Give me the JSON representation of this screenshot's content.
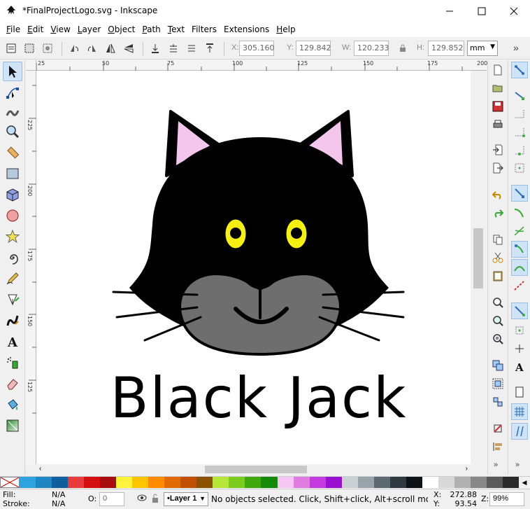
{
  "window": {
    "title": "*FinalProjectLogo.svg - Inkscape",
    "minimize_icon": "minimize-icon",
    "maximize_icon": "maximize-icon",
    "close_icon": "close-icon"
  },
  "menu": {
    "items": [
      {
        "key": "F",
        "rest": "ile"
      },
      {
        "key": "E",
        "rest": "dit"
      },
      {
        "key": "V",
        "rest": "iew"
      },
      {
        "key": "L",
        "rest": "ayer"
      },
      {
        "key": "O",
        "rest": "bject"
      },
      {
        "key": "P",
        "rest": "ath"
      },
      {
        "key": "T",
        "rest": "ext"
      },
      {
        "key": "",
        "rest": "Filters"
      },
      {
        "key": "",
        "rest": "Extensions"
      },
      {
        "key": "H",
        "rest": "elp"
      }
    ]
  },
  "toolbar": {
    "x_label": "X:",
    "x_value": "305.160",
    "y_label": "Y:",
    "y_value": "129.842",
    "w_label": "W:",
    "w_value": "120.233",
    "h_label": "H:",
    "h_value": "129.852",
    "unit": "mm",
    "overflow": "»"
  },
  "rulers": {
    "top_ticks": [
      "25",
      "50",
      "75",
      "100",
      "125",
      "150",
      "175",
      "200"
    ],
    "left_ticks": [
      "225",
      "200",
      "175",
      "150",
      "125"
    ]
  },
  "canvas": {
    "logo_text": "Black Jack",
    "colors": {
      "cat_body": "#000000",
      "ear_inner": "#f4c6ee",
      "eye": "#f5f010",
      "muzzle": "#6e6e6e"
    }
  },
  "palette": {
    "swatches": [
      "#2fa3e0",
      "#1f86c4",
      "#0f5f9e",
      "#e83c3c",
      "#d40f0f",
      "#a80d0d",
      "#fff23a",
      "#ffc400",
      "#ff8c00",
      "#e06a00",
      "#c05000",
      "#8a5200",
      "#b6e63a",
      "#7acd1a",
      "#3ea80e",
      "#138a0a",
      "#f7c6f5",
      "#e07be0",
      "#c43ce0",
      "#9a0fd0",
      "#c8d0d4",
      "#98a4aa",
      "#5a6a70",
      "#2e3a40",
      "#0c1418",
      "#ffffff",
      "#d8d8d8",
      "#b0b0b0",
      "#888888",
      "#5a5a5a",
      "#2a2a2a"
    ]
  },
  "status": {
    "fill_label": "Fill:",
    "fill_value": "N/A",
    "stroke_label": "Stroke:",
    "stroke_value": "N/A",
    "opacity_label": "O:",
    "opacity_value": "0",
    "layer": "•Layer 1",
    "message": "No objects selected. Click, Shift+click, Alt+scroll mouse o...",
    "x_label": "X:",
    "x_value": "272.88",
    "y_label": "Y:",
    "y_value": "93.54",
    "zoom_label": "Z:",
    "zoom_value": "99%"
  }
}
